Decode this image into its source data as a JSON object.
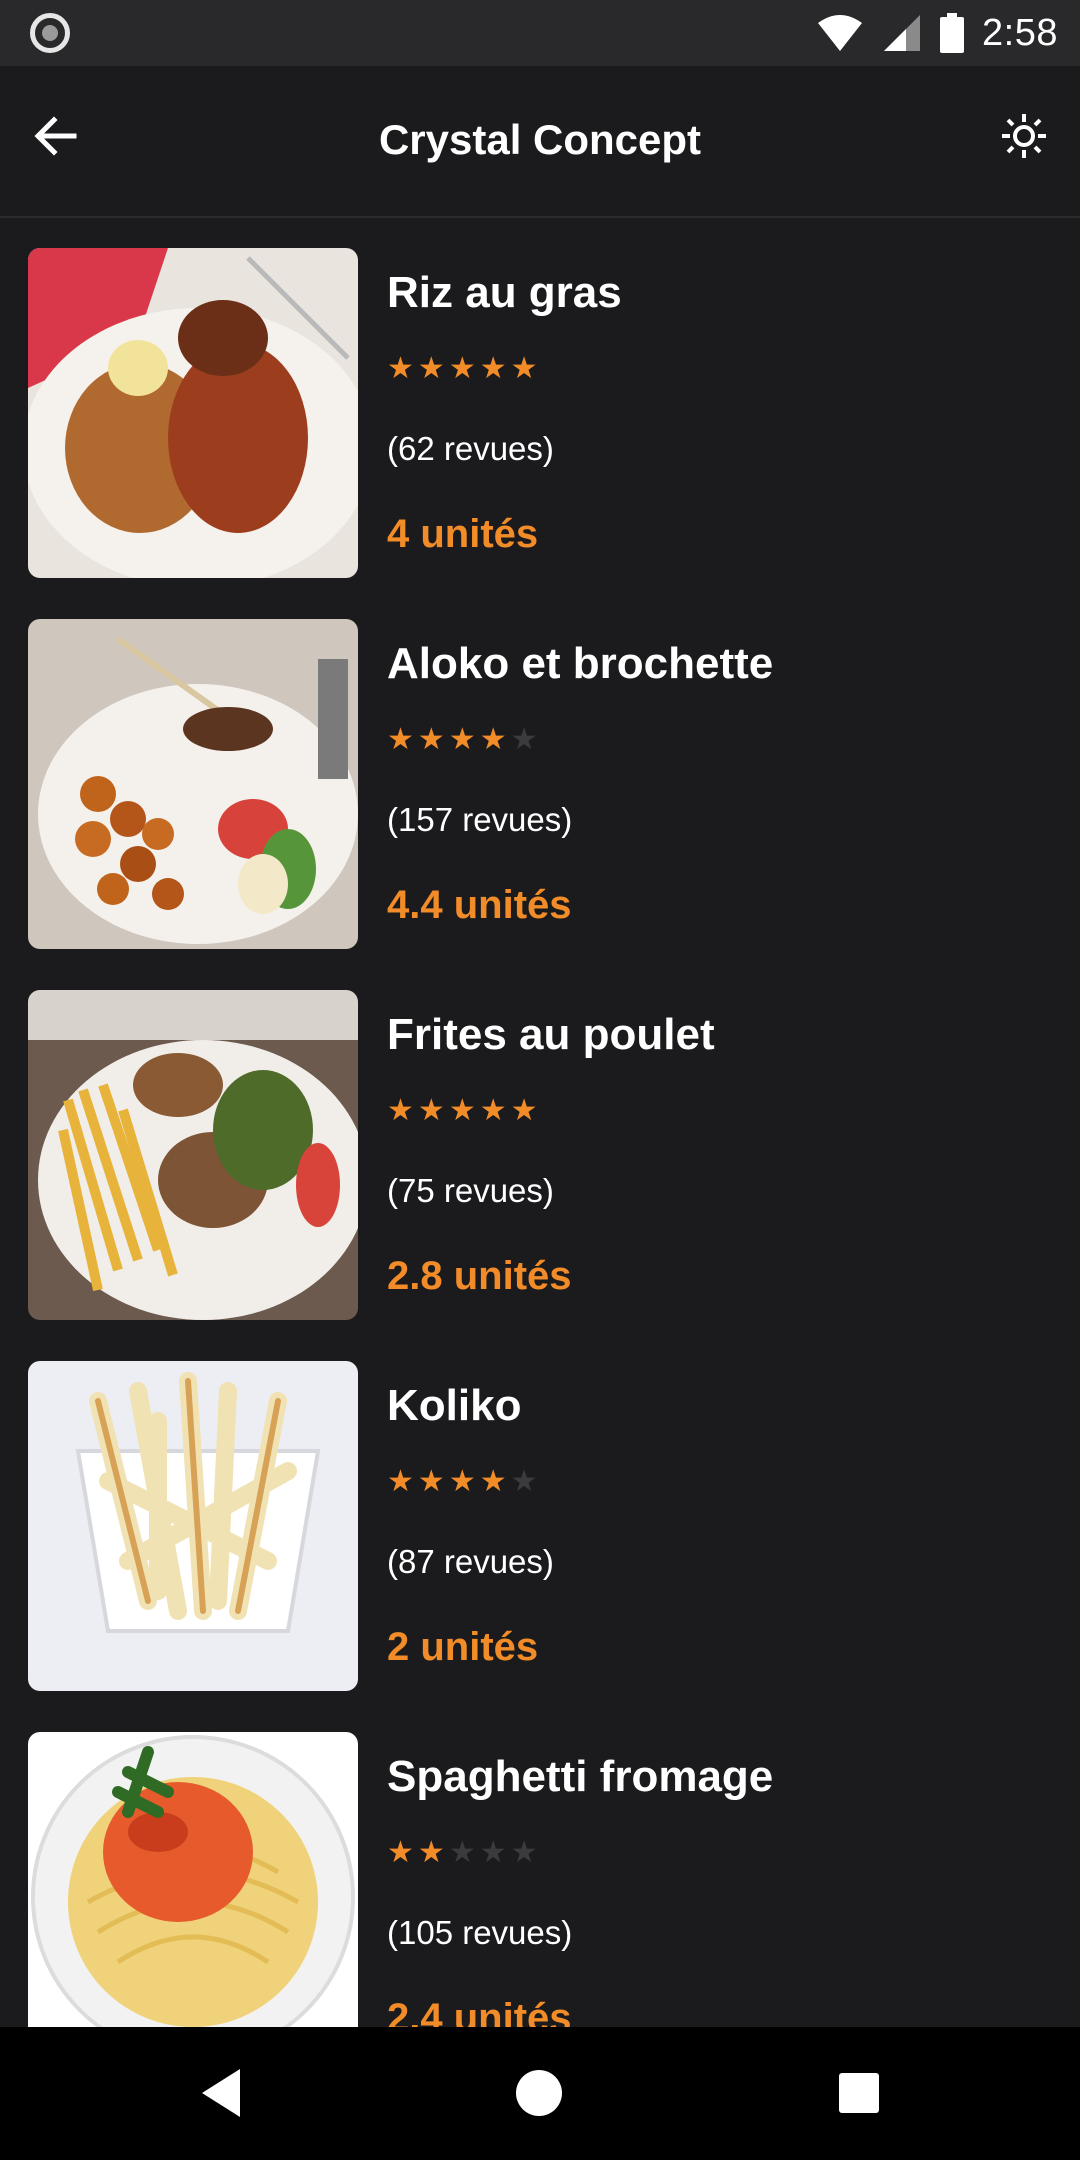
{
  "status_bar": {
    "time": "2:58"
  },
  "app_bar": {
    "title": "Crystal Concept"
  },
  "items": [
    {
      "name": "Riz au gras",
      "rating": 5,
      "reviews": "(62 revues)",
      "units": "4 unités"
    },
    {
      "name": "Aloko et brochette",
      "rating": 4,
      "reviews": "(157 revues)",
      "units": "4.4 unités"
    },
    {
      "name": "Frites au poulet",
      "rating": 5,
      "reviews": "(75 revues)",
      "units": "2.8 unités"
    },
    {
      "name": "Koliko",
      "rating": 4,
      "reviews": "(87 revues)",
      "units": "2 unités"
    },
    {
      "name": "Spaghetti fromage",
      "rating": 2,
      "reviews": "(105 revues)",
      "units": "2.4 unités"
    }
  ],
  "colors": {
    "accent": "#f28c28",
    "background": "#1b1b1e",
    "star_off": "#3b3b3f"
  },
  "icons": {
    "back": "arrow-left-icon",
    "theme": "brightness-icon"
  }
}
